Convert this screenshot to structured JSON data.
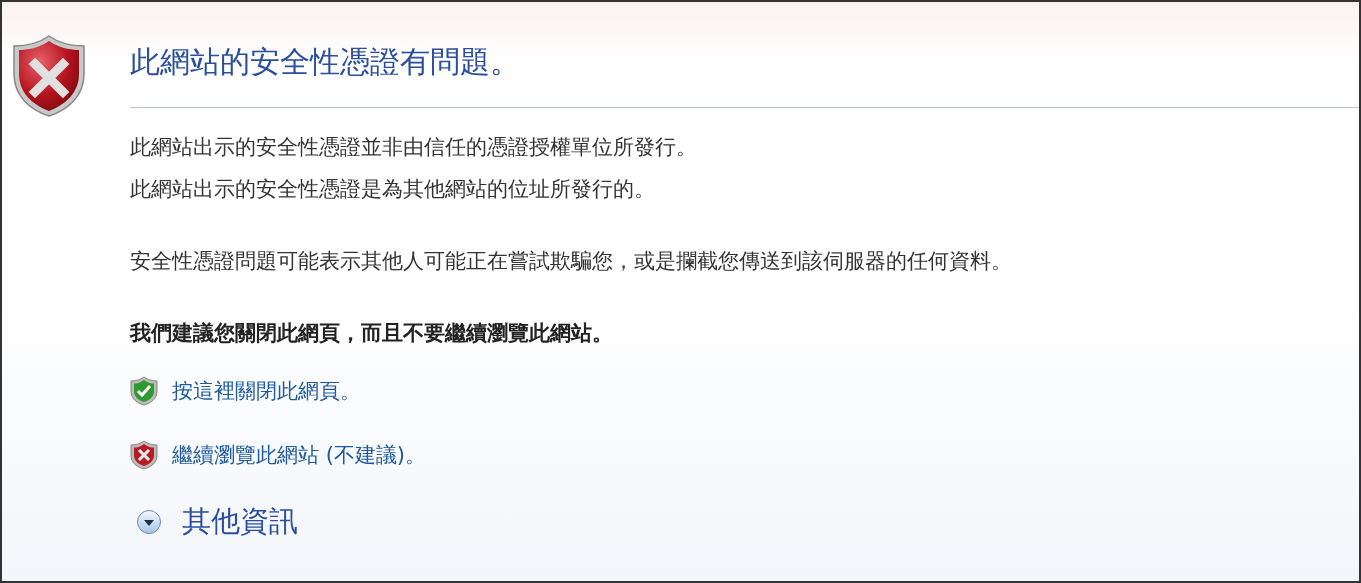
{
  "title": "此網站的安全性憑證有問題。",
  "paragraphs": [
    [
      "此網站出示的安全性憑證並非由信任的憑證授權單位所發行。",
      "此網站出示的安全性憑證是為其他網站的位址所發行的。"
    ],
    [
      "安全性憑證問題可能表示其他人可能正在嘗試欺騙您，或是攔截您傳送到該伺服器的任何資料。"
    ]
  ],
  "recommendation": "我們建議您關閉此網頁，而且不要繼續瀏覽此網站。",
  "links": [
    {
      "kind": "safe",
      "label": "按這裡關閉此網頁。"
    },
    {
      "kind": "unsafe",
      "label": "繼續瀏覽此網站 (不建議)。"
    }
  ],
  "more_info": {
    "label": "其他資訊",
    "expanded": false
  }
}
